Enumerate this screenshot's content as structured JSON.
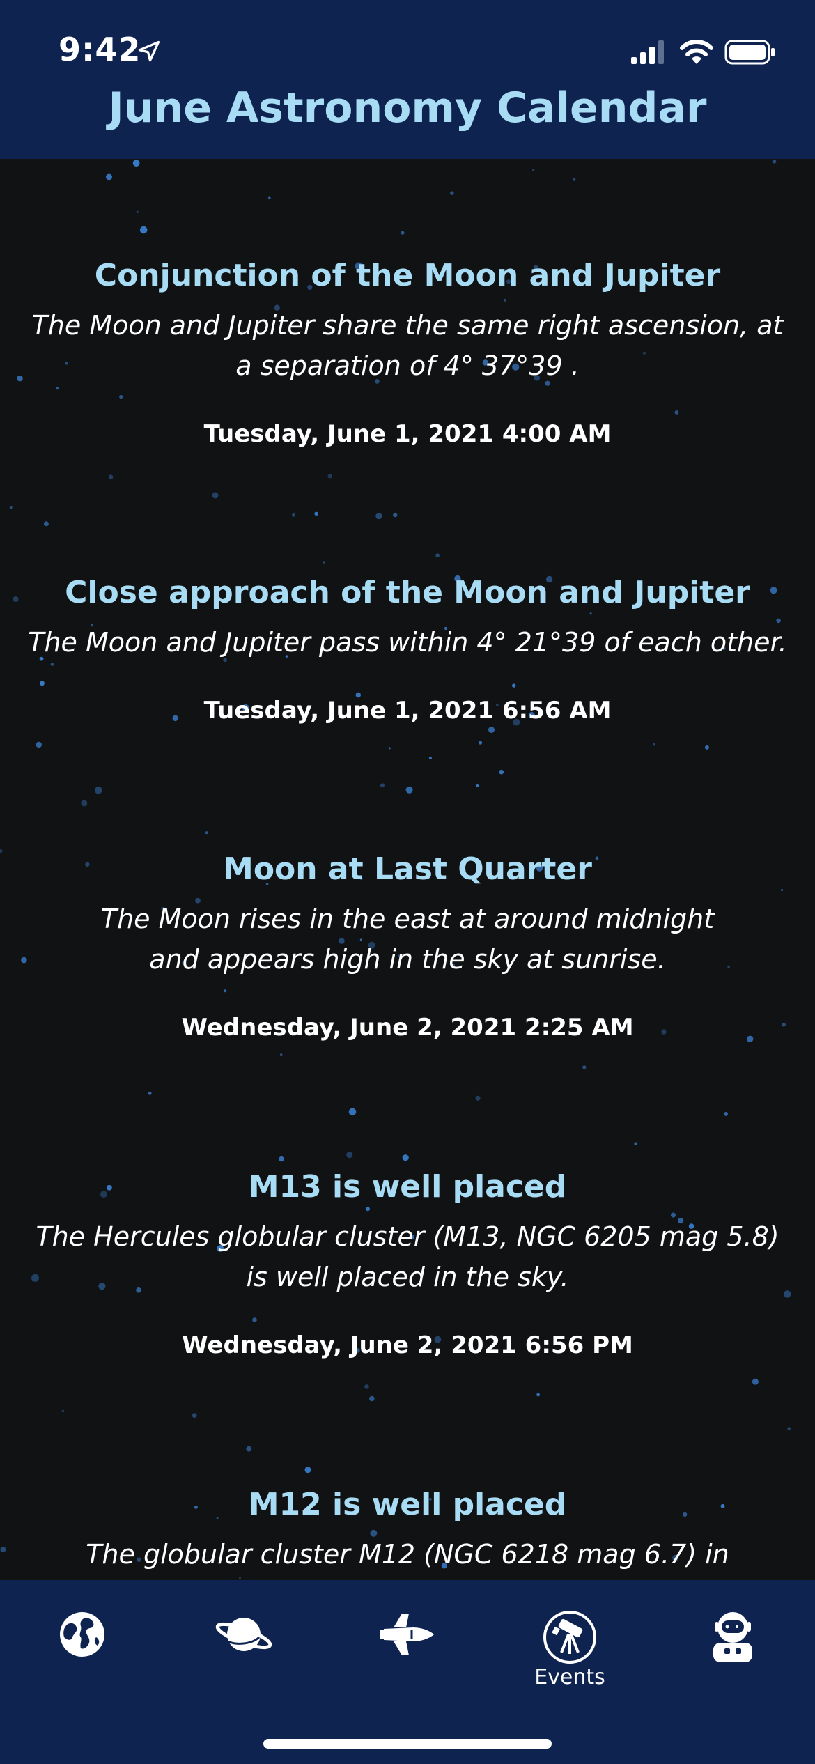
{
  "status_bar": {
    "time": "9:42"
  },
  "header": {
    "title": "June Astronomy Calendar"
  },
  "events": [
    {
      "title": "Conjunction of the Moon and Jupiter",
      "description": "The Moon and Jupiter share the same right ascension, at a separation of 4° 37°39 .",
      "datetime": "Tuesday, June 1, 2021 4:00 AM"
    },
    {
      "title": "Close approach of the Moon and Jupiter",
      "description": "The Moon and Jupiter pass within 4° 21°39  of each other.",
      "datetime": "Tuesday, June 1, 2021 6:56 AM"
    },
    {
      "title": "Moon at Last Quarter",
      "description": "The Moon rises in the east at around midnight and appears high in the sky at sunrise.",
      "datetime": "Wednesday, June 2, 2021 2:25 AM"
    },
    {
      "title": "M13 is well placed",
      "description": "The Hercules globular cluster (M13, NGC 6205  mag 5.8) is well placed in the sky.",
      "datetime": "Wednesday, June 2, 2021 6:56 PM"
    },
    {
      "title": "M12 is well placed",
      "description": "The globular cluster M12 (NGC 6218  mag 6.7) in",
      "datetime": ""
    }
  ],
  "tab_bar": {
    "tabs": [
      {
        "icon": "globe-icon",
        "label": ""
      },
      {
        "icon": "planet-icon",
        "label": ""
      },
      {
        "icon": "space-shuttle-icon",
        "label": ""
      },
      {
        "icon": "telescope-icon",
        "label": "Events"
      },
      {
        "icon": "astronaut-icon",
        "label": ""
      }
    ]
  },
  "colors": {
    "header_bg": "#0e2350",
    "content_bg": "#111214",
    "title_accent": "#a8dcf5",
    "star": "#3a7fd0"
  }
}
